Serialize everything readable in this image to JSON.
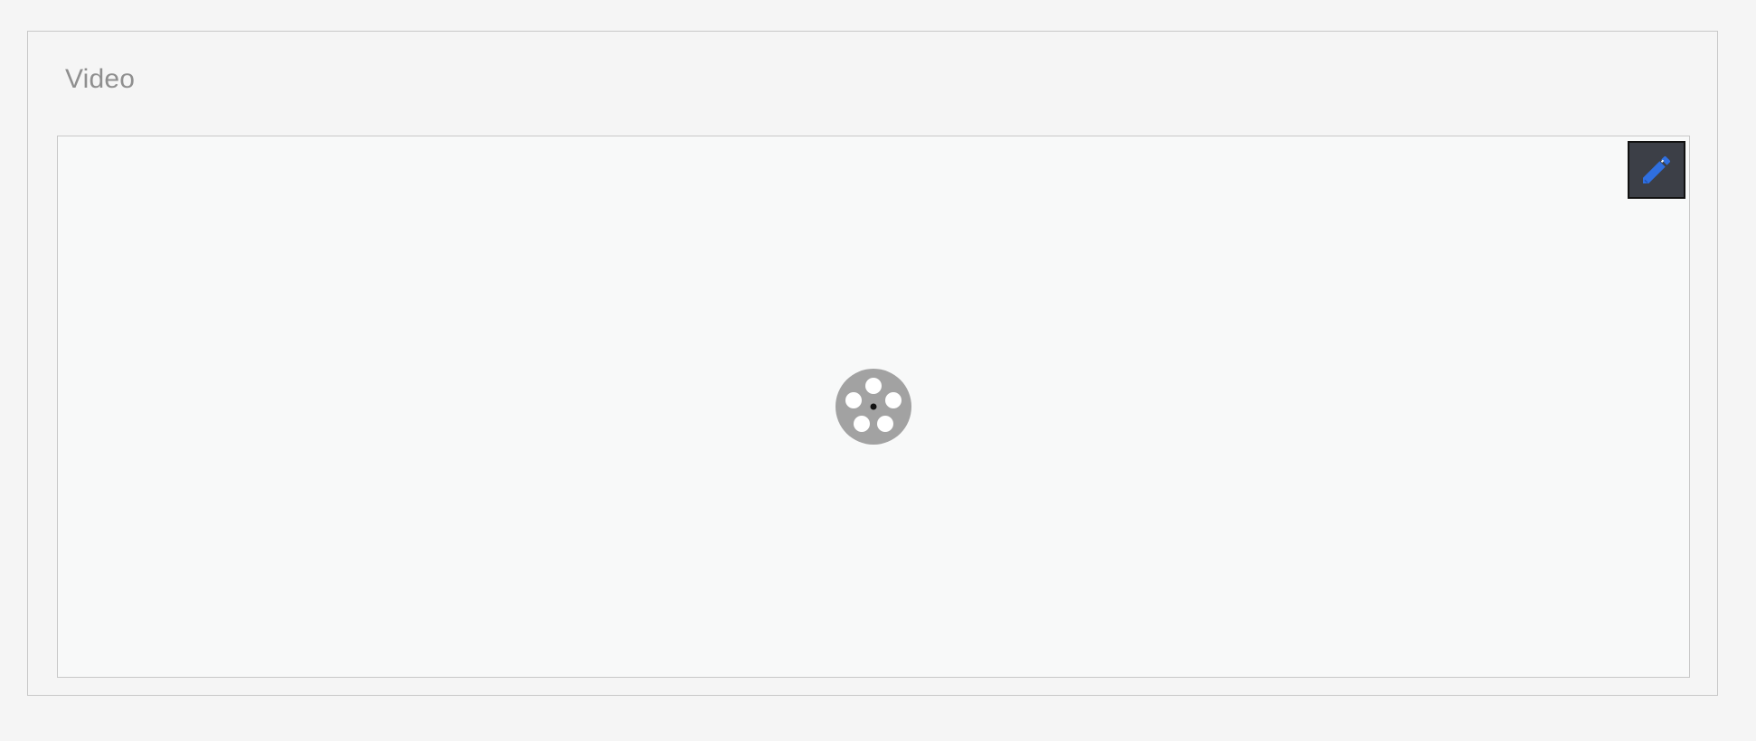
{
  "section": {
    "title": "Video"
  },
  "video": {
    "placeholder_icon": "film-reel-icon",
    "edit_icon": "pencil-icon"
  },
  "colors": {
    "background": "#f5f5f5",
    "title_text": "#8f8f8f",
    "video_area_bg": "#f8f9f9",
    "border": "#c8c8c8",
    "edit_button_bg": "#3c3f47",
    "pencil": "#2f6fe0",
    "reel": "#a2a2a2"
  }
}
